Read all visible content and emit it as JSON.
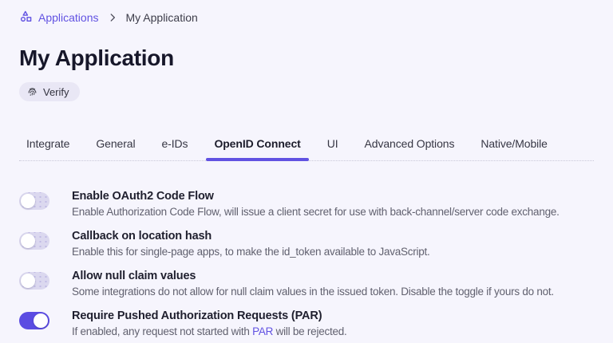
{
  "breadcrumb": {
    "root": {
      "label": "Applications",
      "icon": "shapes-icon"
    },
    "current": {
      "label": "My Application"
    }
  },
  "header": {
    "title": "My Application",
    "verify_badge": {
      "label": "Verify",
      "icon": "fingerprint-icon"
    }
  },
  "tabs": {
    "items": [
      {
        "label": "Integrate",
        "active": false
      },
      {
        "label": "General",
        "active": false
      },
      {
        "label": "e-IDs",
        "active": false
      },
      {
        "label": "OpenID Connect",
        "active": true
      },
      {
        "label": "UI",
        "active": false
      },
      {
        "label": "Advanced Options",
        "active": false
      },
      {
        "label": "Native/Mobile",
        "active": false
      }
    ]
  },
  "settings": {
    "rows": [
      {
        "label": "Enable OAuth2 Code Flow",
        "description": "Enable Authorization Code Flow, will issue a client secret for use with back-channel/server code exchange.",
        "toggle": "off"
      },
      {
        "label": "Callback on location hash",
        "description": "Enable this for single-page apps, to make the id_token available to JavaScript.",
        "toggle": "off"
      },
      {
        "label": "Allow null claim values",
        "description": "Some integrations do not allow for null claim values in the issued token. Disable the toggle if yours do not.",
        "toggle": "off"
      },
      {
        "label": "Require Pushed Authorization Requests (PAR)",
        "description_before": "If enabled, any request not started with ",
        "description_link": "PAR",
        "description_after": " will be rejected.",
        "toggle": "on"
      }
    ]
  },
  "colors": {
    "accent": "#6152e2",
    "background": "#f6f5fd",
    "toggle_on": "#5b4ce2",
    "toggle_off_track": "#dbd8ef",
    "badge_background": "#e9e7f5"
  }
}
